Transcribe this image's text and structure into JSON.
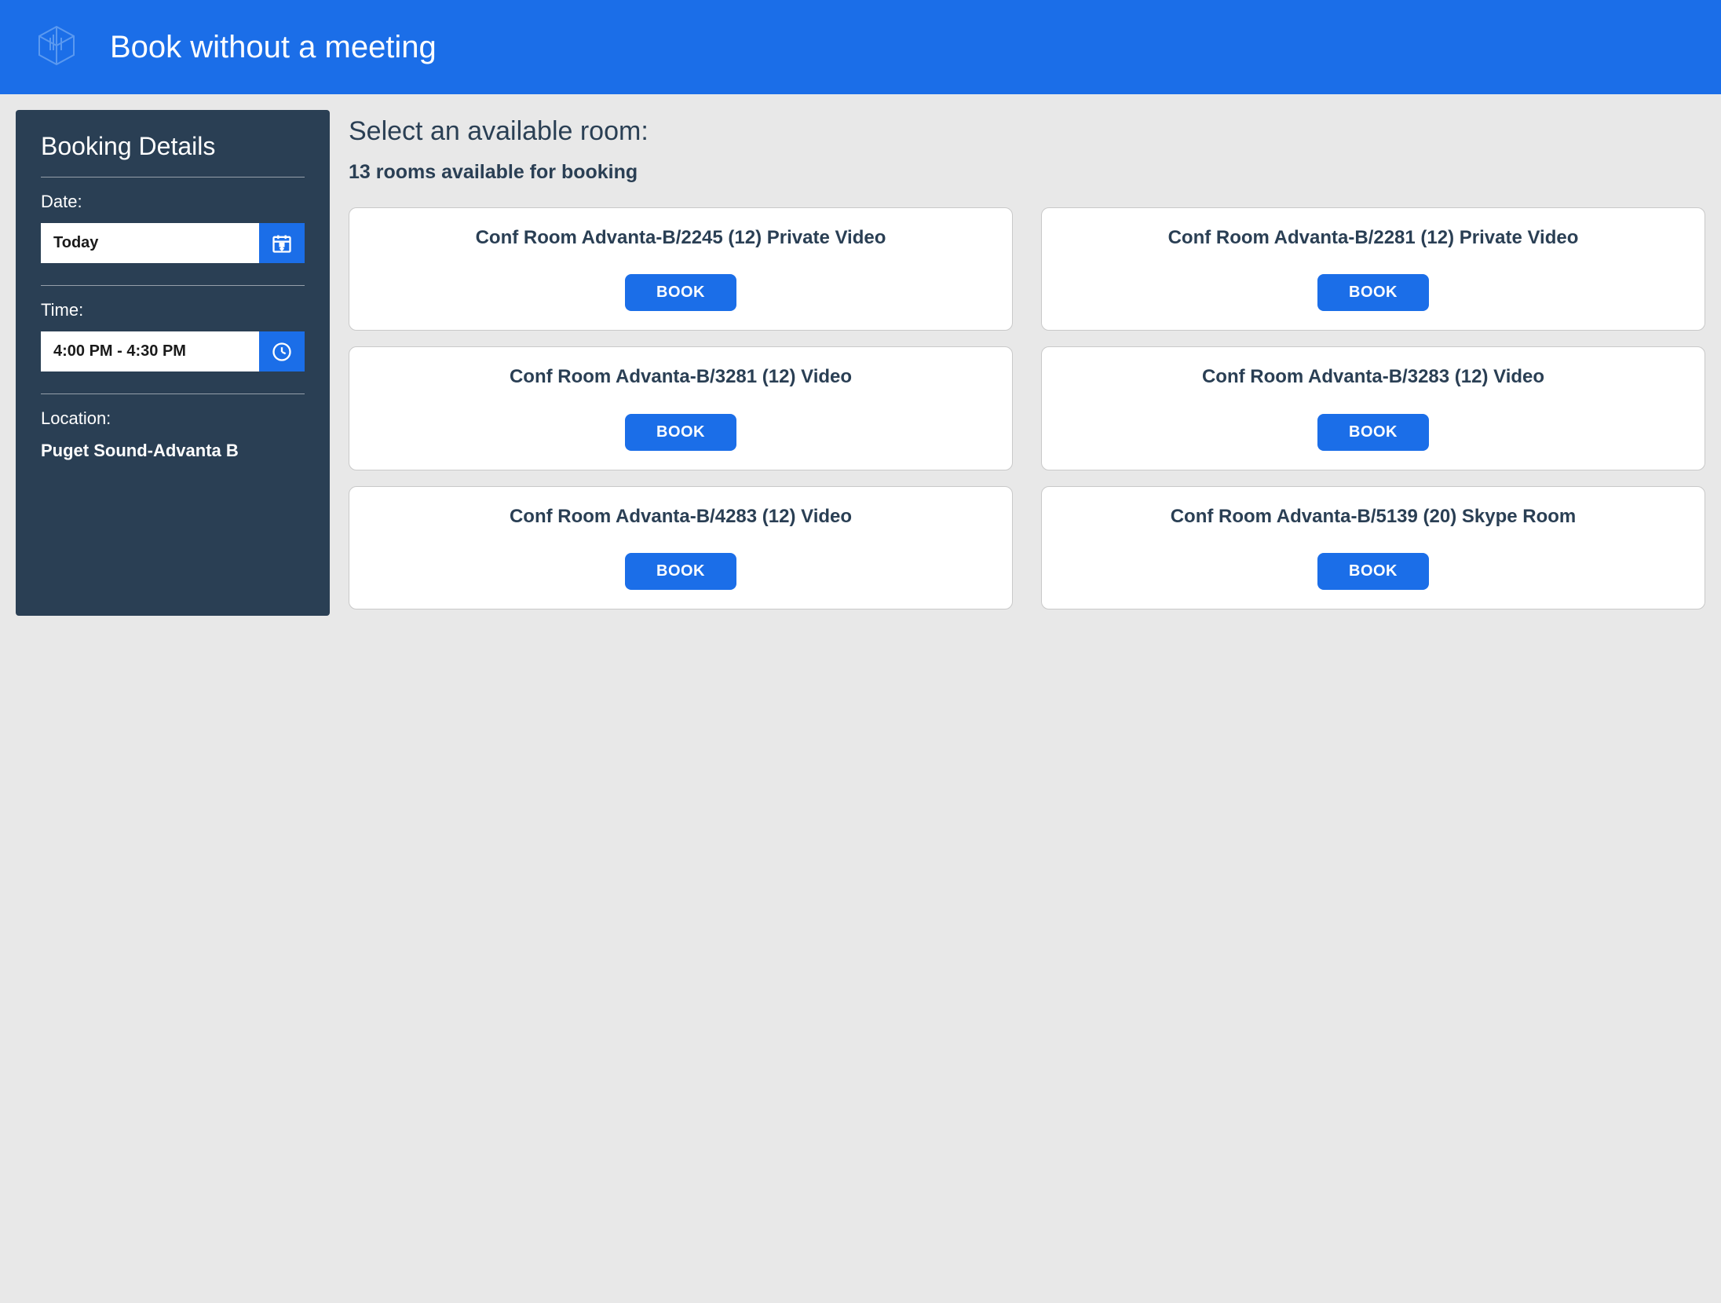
{
  "header": {
    "title": "Book without a meeting"
  },
  "sidebar": {
    "title": "Booking Details",
    "date_label": "Date:",
    "date_value": "Today",
    "time_label": "Time:",
    "time_value": "4:00 PM - 4:30 PM",
    "location_label": "Location:",
    "location_value": "Puget Sound-Advanta B"
  },
  "main": {
    "heading": "Select an available room:",
    "subheading": "13 rooms available for booking",
    "book_label": "BOOK"
  },
  "rooms": [
    {
      "name": "Conf Room Advanta-B/2245 (12) Private Video"
    },
    {
      "name": "Conf Room Advanta-B/2281 (12) Private Video"
    },
    {
      "name": "Conf Room Advanta-B/3281 (12) Video"
    },
    {
      "name": "Conf Room Advanta-B/3283 (12) Video"
    },
    {
      "name": "Conf Room Advanta-B/4283 (12) Video"
    },
    {
      "name": "Conf Room Advanta-B/5139 (20) Skype Room"
    }
  ]
}
